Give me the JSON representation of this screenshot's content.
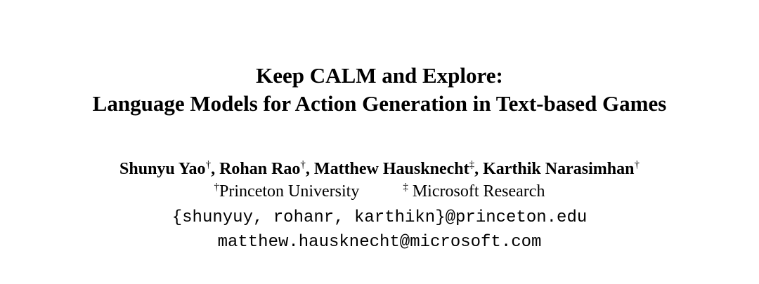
{
  "title": {
    "line1": "Keep CALM and Explore:",
    "line2": "Language Models for Action Generation in Text-based Games"
  },
  "authors": [
    {
      "name": "Shunyu Yao",
      "mark": "†",
      "sep": ", "
    },
    {
      "name": "Rohan Rao",
      "mark": "†",
      "sep": ", "
    },
    {
      "name": "Matthew Hausknecht",
      "mark": "‡",
      "sep": ", "
    },
    {
      "name": "Karthik Narasimhan",
      "mark": "†",
      "sep": ""
    }
  ],
  "affiliations": [
    {
      "mark": "†",
      "name": "Princeton University"
    },
    {
      "mark": "‡",
      "name": " Microsoft Research"
    }
  ],
  "emails": {
    "line1": "{shunyuy, rohanr, karthikn}@princeton.edu",
    "line2": "matthew.hausknecht@microsoft.com"
  }
}
